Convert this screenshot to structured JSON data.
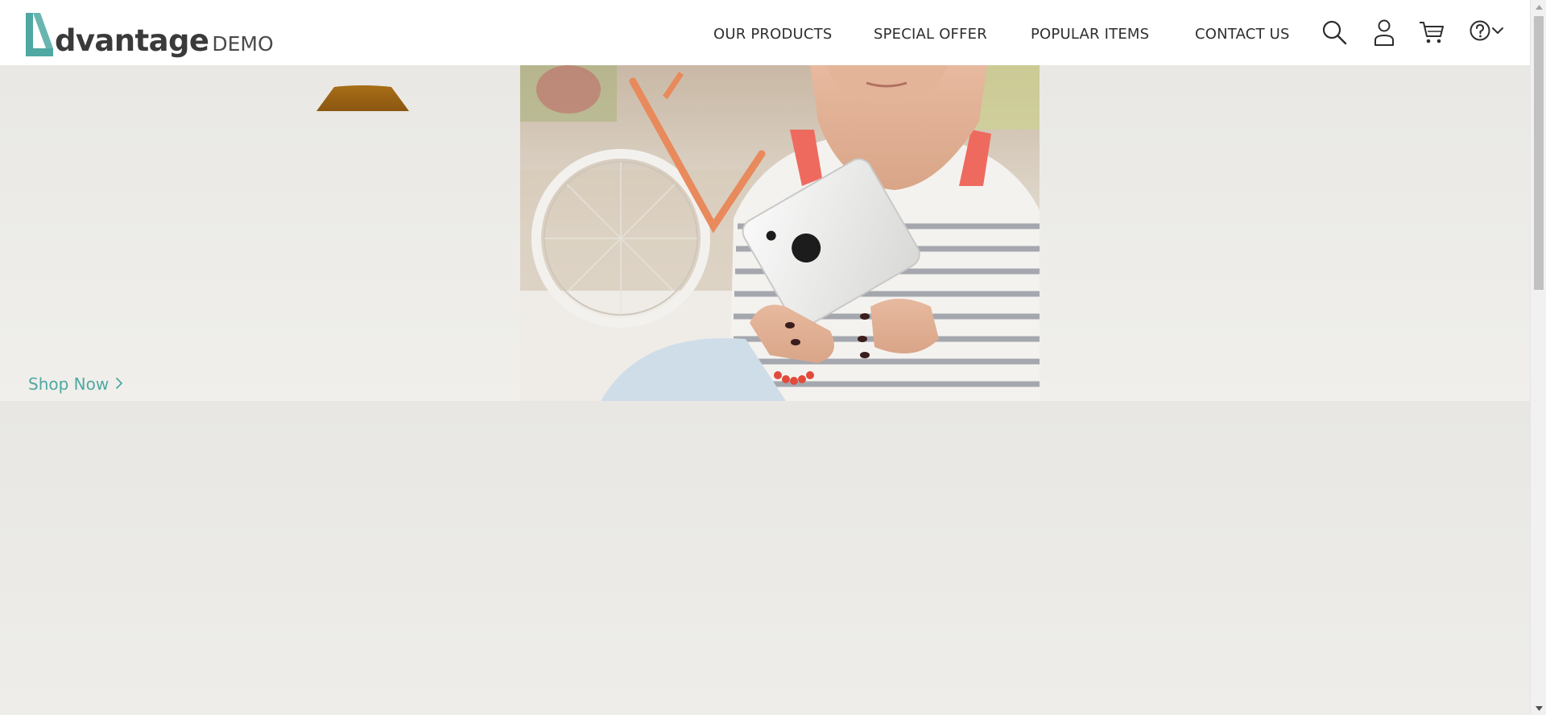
{
  "brand": {
    "name": "dvantage",
    "suffix": "DEMO",
    "accent_color": "#4fa8a2"
  },
  "nav": {
    "items": [
      {
        "label": "OUR PRODUCTS"
      },
      {
        "label": "SPECIAL OFFER"
      },
      {
        "label": "POPULAR ITEMS"
      },
      {
        "label": "CONTACT US"
      }
    ],
    "icons": [
      "search-icon",
      "user-icon",
      "cart-icon",
      "help-icon",
      "chevron-down-icon"
    ]
  },
  "hero": {
    "cta_label": "Shop Now",
    "cta_icon": "chevron-right-icon",
    "image": "woman-holding-tablet-photo"
  },
  "colors": {
    "header_bg": "#ffffff",
    "hero_bg": "#ebeae6",
    "text": "#2e2e2e",
    "lamp": "#9a6414"
  }
}
